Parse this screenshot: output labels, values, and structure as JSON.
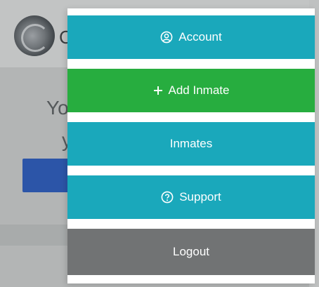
{
  "background": {
    "partial_text_line1": "Yo",
    "partial_text_line2": "y"
  },
  "menu": {
    "items": [
      {
        "label": "Account",
        "icon": "user-circle-icon",
        "color": "#1aa8bb"
      },
      {
        "label": "Add Inmate",
        "icon": "plus-icon",
        "color": "#27ad3f"
      },
      {
        "label": "Inmates",
        "icon": "",
        "color": "#1aa8bb"
      },
      {
        "label": "Support",
        "icon": "question-circle-icon",
        "color": "#1aa8bb"
      },
      {
        "label": "Logout",
        "icon": "",
        "color": "#717374"
      }
    ]
  }
}
